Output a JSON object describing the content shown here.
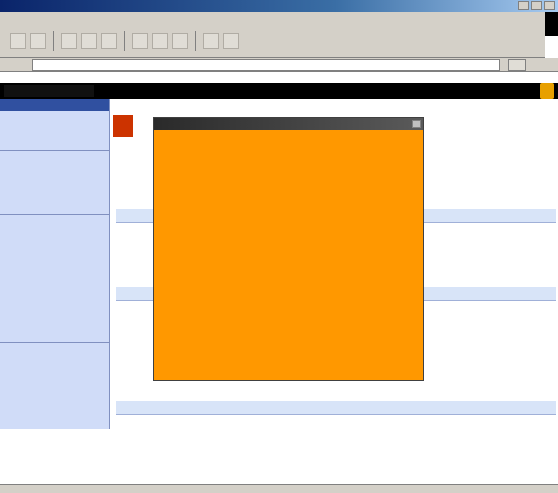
{
  "window": {
    "title": ""
  },
  "menu": {
    "items": [
      "",
      "",
      "",
      "",
      "",
      ""
    ]
  },
  "address": {
    "label": "",
    "value": "",
    "links_label": ""
  },
  "header": {
    "title": "",
    "user": ""
  },
  "left_nav": {
    "top_label": "",
    "sections": [
      {
        "title": "",
        "items": [
          "",
          "",
          ""
        ]
      },
      {
        "title": "",
        "items": [
          "",
          "",
          "",
          "",
          "",
          ""
        ]
      },
      {
        "title": "",
        "items": [
          "",
          "",
          "",
          "",
          "",
          "",
          "",
          "",
          "",
          "",
          "",
          "",
          "",
          ""
        ]
      }
    ]
  },
  "main": {
    "breadcrumb": "",
    "page_link": "",
    "info_lines": [
      "",
      "",
      "",
      ""
    ],
    "sections": [
      {
        "title": "",
        "rows": [
          {
            "link": "",
            "text": ""
          },
          {
            "link": "",
            "text": ""
          }
        ]
      },
      {
        "title": "",
        "rows": [
          {
            "link": "",
            "text": ""
          },
          {
            "link": "",
            "text": ""
          },
          {
            "link": "",
            "text": ""
          }
        ]
      },
      {
        "title": "",
        "rows": [
          {
            "link": "",
            "text": ""
          },
          {
            "link": "",
            "text": ""
          },
          {
            "link": "",
            "text": ""
          }
        ]
      }
    ]
  },
  "popup": {
    "title": "",
    "blocks": [
      {
        "heading": "",
        "lines": []
      },
      {
        "heading": "",
        "lines": [
          "",
          ""
        ]
      },
      {
        "heading": "",
        "lines": [
          ""
        ]
      },
      {
        "heading": "",
        "lines": [
          ""
        ]
      }
    ]
  },
  "status": {
    "text": "",
    "zone": ""
  },
  "colors": {
    "popup_bg": "#ff9800",
    "nav_bg": "#d0dcf8",
    "header_bg": "#000000",
    "link": "#0000cc"
  }
}
